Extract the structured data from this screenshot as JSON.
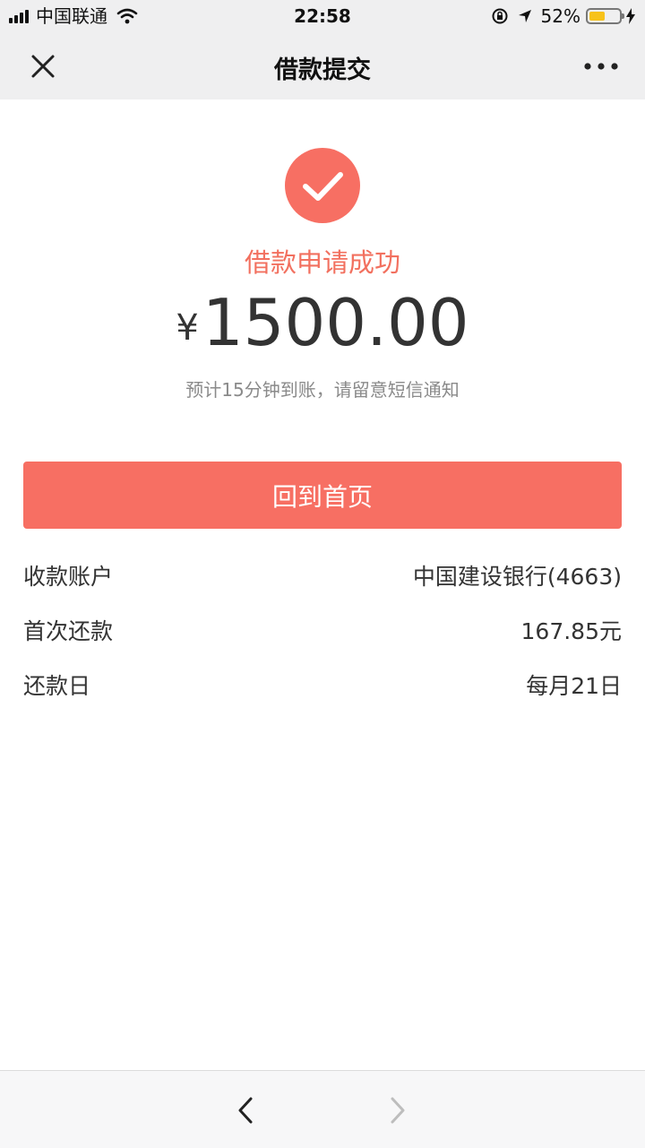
{
  "status_bar": {
    "carrier": "中国联通",
    "time": "22:58",
    "battery_percent": "52%",
    "battery_level": 0.52,
    "icons": [
      "signal-icon",
      "wifi-icon",
      "orientation-lock-icon",
      "location-icon",
      "battery-icon",
      "charging-icon"
    ]
  },
  "nav": {
    "title": "借款提交",
    "close_icon": "close-icon",
    "more_icon": "more-icon"
  },
  "result": {
    "status_text": "借款申请成功",
    "currency_symbol": "¥",
    "amount": "1500.00",
    "note": "预计15分钟到账，请留意短信通知",
    "icon": "checkmark-icon"
  },
  "actions": {
    "home_button": "回到首页"
  },
  "details": [
    {
      "label": "收款账户",
      "value": "中国建设银行(4663)"
    },
    {
      "label": "首次还款",
      "value": "167.85元"
    },
    {
      "label": "还款日",
      "value": "每月21日"
    }
  ],
  "toolbar": {
    "back_icon": "back-arrow-icon",
    "forward_icon": "forward-arrow-icon"
  },
  "colors": {
    "accent": "#f76f63",
    "success_text": "#f2705f",
    "bar_background": "#efeff0",
    "battery": "#f7c21a"
  }
}
